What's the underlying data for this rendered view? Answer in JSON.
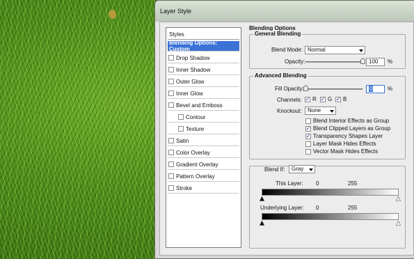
{
  "window": {
    "title": "Layer Style"
  },
  "sidebar": {
    "header": "Styles",
    "items": [
      {
        "label": "Blending Options: Custom",
        "selected": true,
        "checkbox": false,
        "checked": false,
        "indent": false
      },
      {
        "label": "Drop Shadow",
        "selected": false,
        "checkbox": true,
        "checked": false,
        "indent": false
      },
      {
        "label": "Inner Shadow",
        "selected": false,
        "checkbox": true,
        "checked": false,
        "indent": false
      },
      {
        "label": "Outer Glow",
        "selected": false,
        "checkbox": true,
        "checked": false,
        "indent": false
      },
      {
        "label": "Inner Glow",
        "selected": false,
        "checkbox": true,
        "checked": false,
        "indent": false
      },
      {
        "label": "Bevel and Emboss",
        "selected": false,
        "checkbox": true,
        "checked": false,
        "indent": false
      },
      {
        "label": "Contour",
        "selected": false,
        "checkbox": true,
        "checked": false,
        "indent": true
      },
      {
        "label": "Texture",
        "selected": false,
        "checkbox": true,
        "checked": false,
        "indent": true
      },
      {
        "label": "Satin",
        "selected": false,
        "checkbox": true,
        "checked": false,
        "indent": false
      },
      {
        "label": "Color Overlay",
        "selected": false,
        "checkbox": true,
        "checked": false,
        "indent": false
      },
      {
        "label": "Gradient Overlay",
        "selected": false,
        "checkbox": true,
        "checked": false,
        "indent": false
      },
      {
        "label": "Pattern Overlay",
        "selected": false,
        "checkbox": true,
        "checked": false,
        "indent": false
      },
      {
        "label": "Stroke",
        "selected": false,
        "checkbox": true,
        "checked": false,
        "indent": false
      }
    ]
  },
  "blending": {
    "section_title": "Blending Options",
    "general": {
      "title": "General Blending",
      "blend_mode_label": "Blend Mode:",
      "blend_mode_value": "Normal",
      "opacity_label": "Opacity:",
      "opacity_value": "100",
      "opacity_unit": "%",
      "opacity_level": 1.0
    },
    "advanced": {
      "title": "Advanced Blending",
      "fill_opacity_label": "Fill Opacity:",
      "fill_opacity_value": "0",
      "fill_opacity_unit": "%",
      "fill_opacity_level": 0.0,
      "channels_label": "Channels:",
      "channels": [
        {
          "label": "R",
          "checked": true
        },
        {
          "label": "G",
          "checked": true
        },
        {
          "label": "B",
          "checked": true
        }
      ],
      "knockout_label": "Knockout:",
      "knockout_value": "None",
      "options": [
        {
          "label": "Blend Interior Effects as Group",
          "checked": false
        },
        {
          "label": "Blend Clipped Layers as Group",
          "checked": true
        },
        {
          "label": "Transparency Shapes Layer",
          "checked": true
        },
        {
          "label": "Layer Mask Hides Effects",
          "checked": false
        },
        {
          "label": "Vector Mask Hides Effects",
          "checked": false
        }
      ]
    },
    "blend_if": {
      "label": "Blend If:",
      "value": "Gray",
      "this_layer_label": "This Layer:",
      "this_layer_min": "0",
      "this_layer_max": "255",
      "underlying_label": "Underlying Layer:",
      "underlying_min": "0",
      "underlying_max": "255"
    }
  },
  "icons": {
    "checkmark": "check-icon",
    "dropdown": "chevron-down-icon"
  }
}
